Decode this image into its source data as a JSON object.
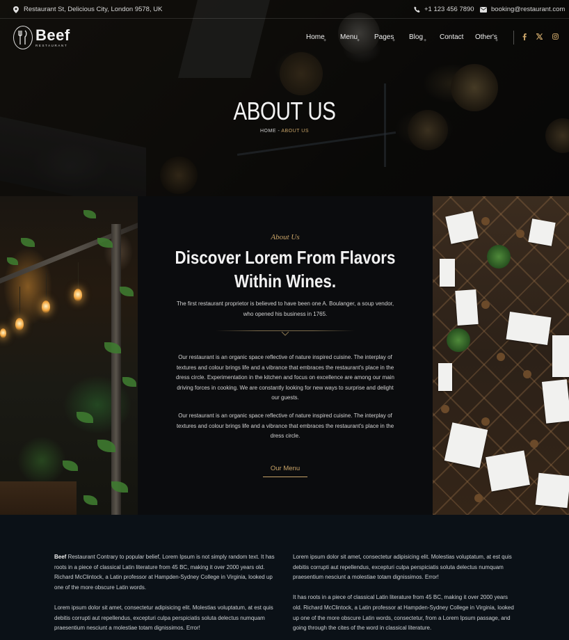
{
  "topbar": {
    "address": "Restaurant St, Delicious City, London 9578, UK",
    "phone": "+1 123 456 7890",
    "email": "booking@restaurant.com",
    "icons": [
      "map-marker-icon",
      "phone-icon",
      "envelope-icon"
    ]
  },
  "brand": {
    "name": "Beef",
    "tagline": "RESTAURANT"
  },
  "nav": {
    "items": [
      "Home",
      "Menu",
      "Pages",
      "Blog",
      "Contact",
      "Other's"
    ],
    "social": [
      "facebook-icon",
      "x-twitter-icon",
      "instagram-icon"
    ]
  },
  "hero": {
    "title": "ABOUT US",
    "breadcrumb_home": "HOME",
    "breadcrumb_sep": " - ",
    "breadcrumb_current": "ABOUT US"
  },
  "about": {
    "subtitle": "About Us",
    "heading_line1": "Discover Lorem From Flavors",
    "heading_line2": "Within Wines.",
    "intro": "The first restaurant proprietor is believed to have been one A. Boulanger, a soup vendor, who opened his business in 1765.",
    "para1": "Our restaurant is an organic space reflective of nature inspired cuisine. The interplay of textures and colour brings life and a vibrance that embraces the restaurant's place in the dress circle. Experimentation in the kitchen and focus on excellence are among our main driving forces in cooking. We are constantly looking for new ways to surprise and delight our guests.",
    "para2": "Our restaurant is an organic space reflective of nature inspired cuisine. The interplay of textures and colour brings life and a vibrance that embraces the restaurant's place in the dress circle.",
    "button": "Our Menu"
  },
  "bottom": {
    "left_bold": "Beef",
    "left_p1": " Restaurant Contrary to popular belief, Lorem Ipsum is not simply random text. It has roots in a piece of classical Latin literature from 45 BC, making it over 2000 years old. Richard McClintock, a Latin professor at Hampden-Sydney College in Virginia, looked up one of the more obscure Latin words.",
    "left_p2": "Lorem ipsum dolor sit amet, consectetur adipisicing elit. Molestias voluptatum, at est quis debitis corrupti aut repellendus, excepturi culpa perspiciatis soluta delectus numquam praesentium nesciunt a molestiae totam dignissimos. Error!",
    "right_p1": "Lorem ipsum dolor sit amet, consectetur adipisicing elit. Molestias voluptatum, at est quis debitis corrupti aut repellendus, excepturi culpa perspiciatis soluta delectus numquam praesentium nesciunt a molestiae totam dignissimos. Error!",
    "right_p2": "It has roots in a piece of classical Latin literature from 45 BC, making it over 2000 years old. Richard McClintock, a Latin professor at Hampden-Sydney College in Virginia, looked up one of the more obscure Latin words, consectetur, from a Lorem Ipsum passage, and going through the cites of the word in classical literature."
  },
  "colors": {
    "accent": "#c9a468",
    "background": "#0b1117",
    "panel": "#0b0c0e"
  }
}
